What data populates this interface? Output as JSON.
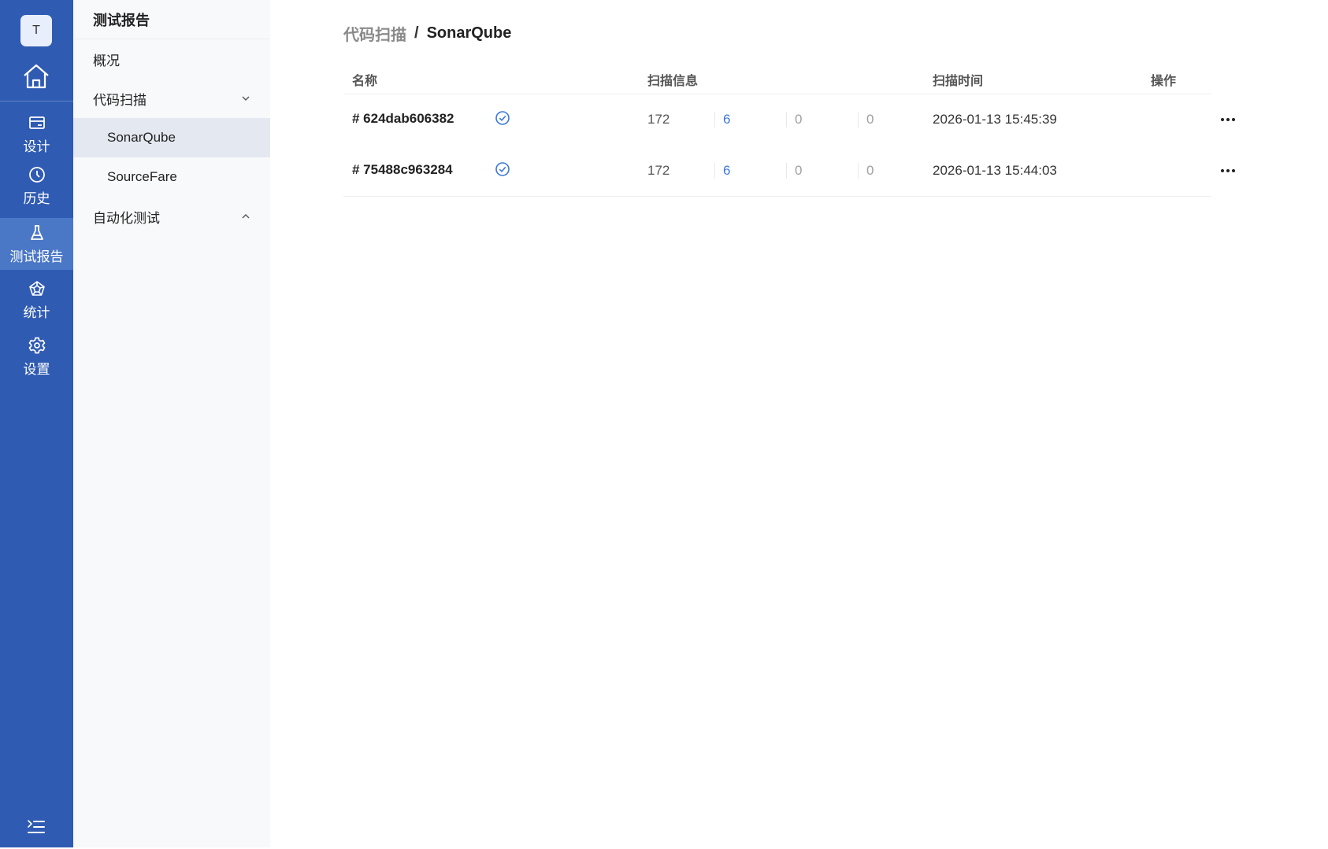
{
  "rail": {
    "avatar_letter": "T",
    "items": [
      {
        "label": "设计",
        "icon": "card-icon"
      },
      {
        "label": "历史",
        "icon": "clock-icon"
      },
      {
        "label": "测试报告",
        "icon": "flask-icon"
      },
      {
        "label": "统计",
        "icon": "radar-icon"
      },
      {
        "label": "设置",
        "icon": "gear-icon"
      }
    ],
    "active_item": "测试报告"
  },
  "sidebar": {
    "title": "测试报告",
    "items": [
      {
        "label": "概况"
      },
      {
        "label": "代码扫描",
        "expanded": true
      },
      {
        "label": "SonarQube",
        "selected": true
      },
      {
        "label": "SourceFare"
      },
      {
        "label": "自动化测试",
        "expanded": false
      }
    ]
  },
  "breadcrumb": {
    "parent": "代码扫描",
    "separator": "/",
    "current": "SonarQube"
  },
  "table": {
    "columns": [
      "名称",
      "扫描信息",
      "扫描时间",
      "操作"
    ],
    "rows": [
      {
        "name": "# 624dab606382",
        "status": "check-circle-icon",
        "metrics": [
          "172",
          "6",
          "0",
          "0"
        ],
        "time": "2026-01-13 15:45:39"
      },
      {
        "name": "# 75488c963284",
        "status": "check-circle-icon",
        "metrics": [
          "172",
          "6",
          "0",
          "0"
        ],
        "time": "2026-01-13 15:44:03"
      }
    ]
  },
  "colors": {
    "rail": "#2f5bb3",
    "rail_active": "#4b77c7",
    "accent": "#3b78d6"
  }
}
